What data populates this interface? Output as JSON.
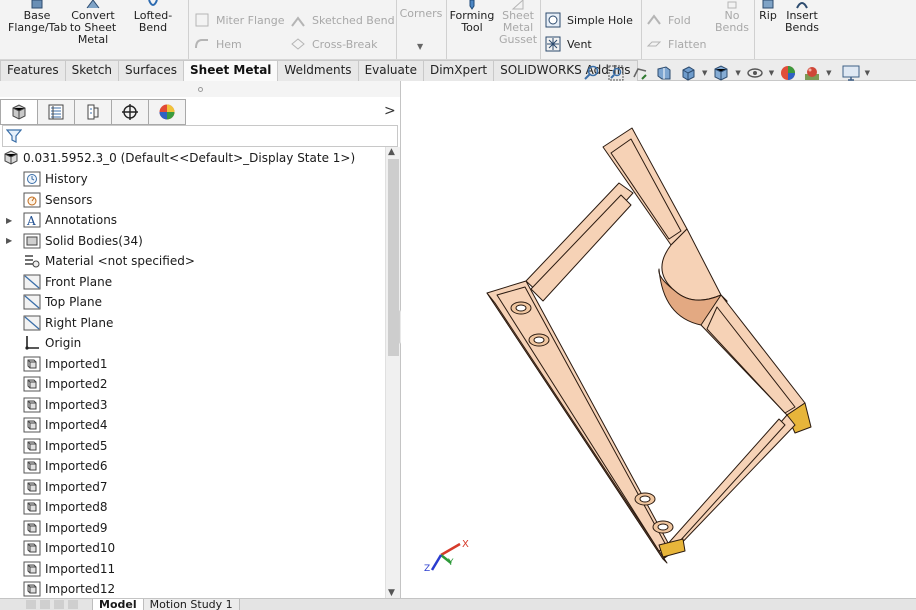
{
  "ribbon": {
    "base_flange": "Base\nFlange/Tab",
    "convert": "Convert\nto Sheet\nMetal",
    "lofted_bend": "Lofted-Bend",
    "miter_flange": "Miter Flange",
    "hem": "Hem",
    "sketched_bend": "Sketched Bend",
    "cross_break": "Cross-Break",
    "corners": "Corners",
    "forming_tool": "Forming\nTool",
    "gusset": "Sheet\nMetal\nGusset",
    "simple_hole": "Simple Hole",
    "vent": "Vent",
    "fold": "Fold",
    "flatten": "Flatten",
    "no_bends": "No\nBends",
    "rip": "Rip",
    "insert_bends": "Insert\nBends"
  },
  "tabs": [
    "Features",
    "Sketch",
    "Surfaces",
    "Sheet Metal",
    "Weldments",
    "Evaluate",
    "DimXpert",
    "SOLIDWORKS Add-Ins"
  ],
  "active_tab": "Sheet Metal",
  "tree": {
    "root": "0.031.5952.3_0  (Default<<Default>_Display State 1>)",
    "items": [
      {
        "label": "History",
        "icon": "history-icon",
        "expandable": false
      },
      {
        "label": "Sensors",
        "icon": "sensor-icon",
        "expandable": false
      },
      {
        "label": "Annotations",
        "icon": "annotations-icon",
        "expandable": true
      },
      {
        "label": "Solid Bodies(34)",
        "icon": "solid-bodies-icon",
        "expandable": true
      },
      {
        "label": "Material <not specified>",
        "icon": "material-icon",
        "expandable": false
      },
      {
        "label": "Front Plane",
        "icon": "plane-icon",
        "expandable": false
      },
      {
        "label": "Top Plane",
        "icon": "plane-icon",
        "expandable": false
      },
      {
        "label": "Right Plane",
        "icon": "plane-icon",
        "expandable": false
      },
      {
        "label": "Origin",
        "icon": "origin-icon",
        "expandable": false
      },
      {
        "label": "Imported1",
        "icon": "imported-body-icon",
        "expandable": false
      },
      {
        "label": "Imported2",
        "icon": "imported-body-icon",
        "expandable": false
      },
      {
        "label": "Imported3",
        "icon": "imported-body-icon",
        "expandable": false
      },
      {
        "label": "Imported4",
        "icon": "imported-body-icon",
        "expandable": false
      },
      {
        "label": "Imported5",
        "icon": "imported-body-icon",
        "expandable": false
      },
      {
        "label": "Imported6",
        "icon": "imported-body-icon",
        "expandable": false
      },
      {
        "label": "Imported7",
        "icon": "imported-body-icon",
        "expandable": false
      },
      {
        "label": "Imported8",
        "icon": "imported-body-icon",
        "expandable": false
      },
      {
        "label": "Imported9",
        "icon": "imported-body-icon",
        "expandable": false
      },
      {
        "label": "Imported10",
        "icon": "imported-body-icon",
        "expandable": false
      },
      {
        "label": "Imported11",
        "icon": "imported-body-icon",
        "expandable": false
      },
      {
        "label": "Imported12",
        "icon": "imported-body-icon",
        "expandable": false
      }
    ]
  },
  "bottom_tabs": [
    "Model",
    "Motion Study 1"
  ],
  "active_bottom_tab": "Model",
  "triad": {
    "x": "X",
    "y": "Y",
    "z": "Z"
  },
  "colors": {
    "part_face": "#f6d2b6",
    "part_edge": "#2a1a10",
    "part_shadow": "#e3a982",
    "triad_x": "#d63a2a",
    "triad_y": "#2e9a3a",
    "triad_z": "#2a3ccf"
  }
}
